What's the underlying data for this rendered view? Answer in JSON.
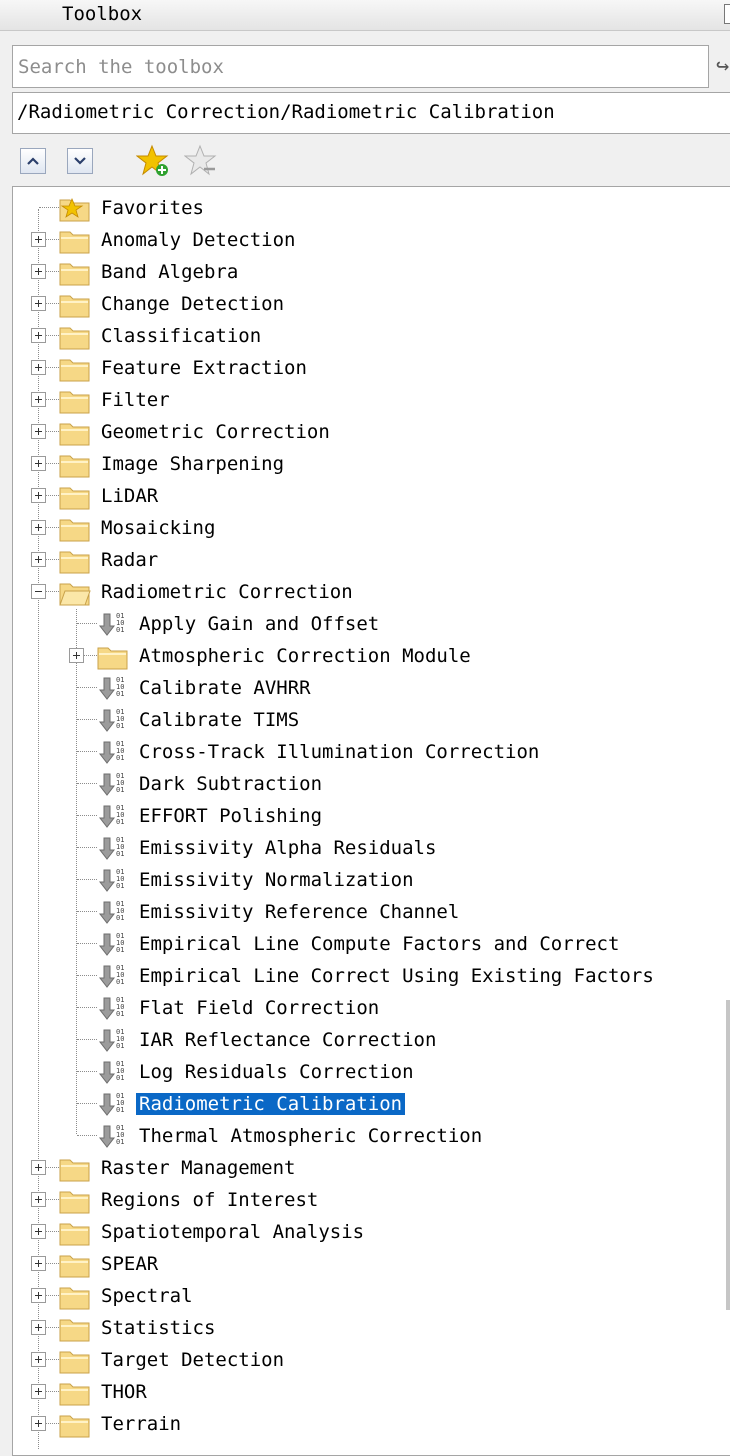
{
  "window": {
    "title": "Toolbox"
  },
  "search": {
    "placeholder": "Search the toolbox",
    "value": ""
  },
  "path_bar": {
    "text": "/Radiometric Correction/Radiometric Calibration"
  },
  "toolbar": {
    "buttons": [
      {
        "name": "move-up-button",
        "icon": "chevron-up-icon"
      },
      {
        "name": "move-down-button",
        "icon": "chevron-down-icon"
      },
      {
        "name": "add-favorite-button",
        "icon": "star-add-icon"
      },
      {
        "name": "remove-favorite-button",
        "icon": "star-remove-icon"
      }
    ]
  },
  "tree": {
    "selected": "Radiometric Calibration",
    "items": [
      {
        "label": "Favorites",
        "type": "favorites",
        "level": 0,
        "expander": "none"
      },
      {
        "label": "Anomaly Detection",
        "type": "folder",
        "level": 0,
        "expander": "plus"
      },
      {
        "label": "Band Algebra",
        "type": "folder",
        "level": 0,
        "expander": "plus"
      },
      {
        "label": "Change Detection",
        "type": "folder",
        "level": 0,
        "expander": "plus"
      },
      {
        "label": "Classification",
        "type": "folder",
        "level": 0,
        "expander": "plus"
      },
      {
        "label": "Feature Extraction",
        "type": "folder",
        "level": 0,
        "expander": "plus"
      },
      {
        "label": "Filter",
        "type": "folder",
        "level": 0,
        "expander": "plus"
      },
      {
        "label": "Geometric Correction",
        "type": "folder",
        "level": 0,
        "expander": "plus"
      },
      {
        "label": "Image Sharpening",
        "type": "folder",
        "level": 0,
        "expander": "plus"
      },
      {
        "label": "LiDAR",
        "type": "folder",
        "level": 0,
        "expander": "plus"
      },
      {
        "label": "Mosaicking",
        "type": "folder",
        "level": 0,
        "expander": "plus"
      },
      {
        "label": "Radar",
        "type": "folder",
        "level": 0,
        "expander": "plus"
      },
      {
        "label": "Radiometric Correction",
        "type": "folder-open",
        "level": 0,
        "expander": "minus"
      },
      {
        "label": "Apply Gain and Offset",
        "type": "tool",
        "level": 1
      },
      {
        "label": "Atmospheric Correction Module",
        "type": "folder",
        "level": 1,
        "expander": "plus"
      },
      {
        "label": "Calibrate AVHRR",
        "type": "tool",
        "level": 1
      },
      {
        "label": "Calibrate TIMS",
        "type": "tool",
        "level": 1
      },
      {
        "label": "Cross-Track Illumination Correction",
        "type": "tool",
        "level": 1
      },
      {
        "label": "Dark Subtraction",
        "type": "tool",
        "level": 1
      },
      {
        "label": "EFFORT Polishing",
        "type": "tool",
        "level": 1
      },
      {
        "label": "Emissivity Alpha Residuals",
        "type": "tool",
        "level": 1
      },
      {
        "label": "Emissivity Normalization",
        "type": "tool",
        "level": 1
      },
      {
        "label": "Emissivity Reference Channel",
        "type": "tool",
        "level": 1
      },
      {
        "label": "Empirical Line Compute Factors and Correct",
        "type": "tool",
        "level": 1
      },
      {
        "label": "Empirical Line Correct Using Existing Factors",
        "type": "tool",
        "level": 1
      },
      {
        "label": "Flat Field Correction",
        "type": "tool",
        "level": 1
      },
      {
        "label": "IAR Reflectance Correction",
        "type": "tool",
        "level": 1
      },
      {
        "label": "Log Residuals Correction",
        "type": "tool",
        "level": 1
      },
      {
        "label": "Radiometric Calibration",
        "type": "tool",
        "level": 1,
        "selected": true
      },
      {
        "label": "Thermal Atmospheric Correction",
        "type": "tool",
        "level": 1
      },
      {
        "label": "Raster Management",
        "type": "folder",
        "level": 0,
        "expander": "plus"
      },
      {
        "label": "Regions of Interest",
        "type": "folder",
        "level": 0,
        "expander": "plus"
      },
      {
        "label": "Spatiotemporal Analysis",
        "type": "folder",
        "level": 0,
        "expander": "plus"
      },
      {
        "label": "SPEAR",
        "type": "folder",
        "level": 0,
        "expander": "plus"
      },
      {
        "label": "Spectral",
        "type": "folder",
        "level": 0,
        "expander": "plus"
      },
      {
        "label": "Statistics",
        "type": "folder",
        "level": 0,
        "expander": "plus"
      },
      {
        "label": "Target Detection",
        "type": "folder",
        "level": 0,
        "expander": "plus"
      },
      {
        "label": "THOR",
        "type": "folder",
        "level": 0,
        "expander": "plus"
      },
      {
        "label": "Terrain",
        "type": "folder",
        "level": 0,
        "expander": "plus"
      }
    ]
  },
  "colors": {
    "selection": "#0a68c6",
    "folder": "#f6d886",
    "star": "#f2c200"
  }
}
